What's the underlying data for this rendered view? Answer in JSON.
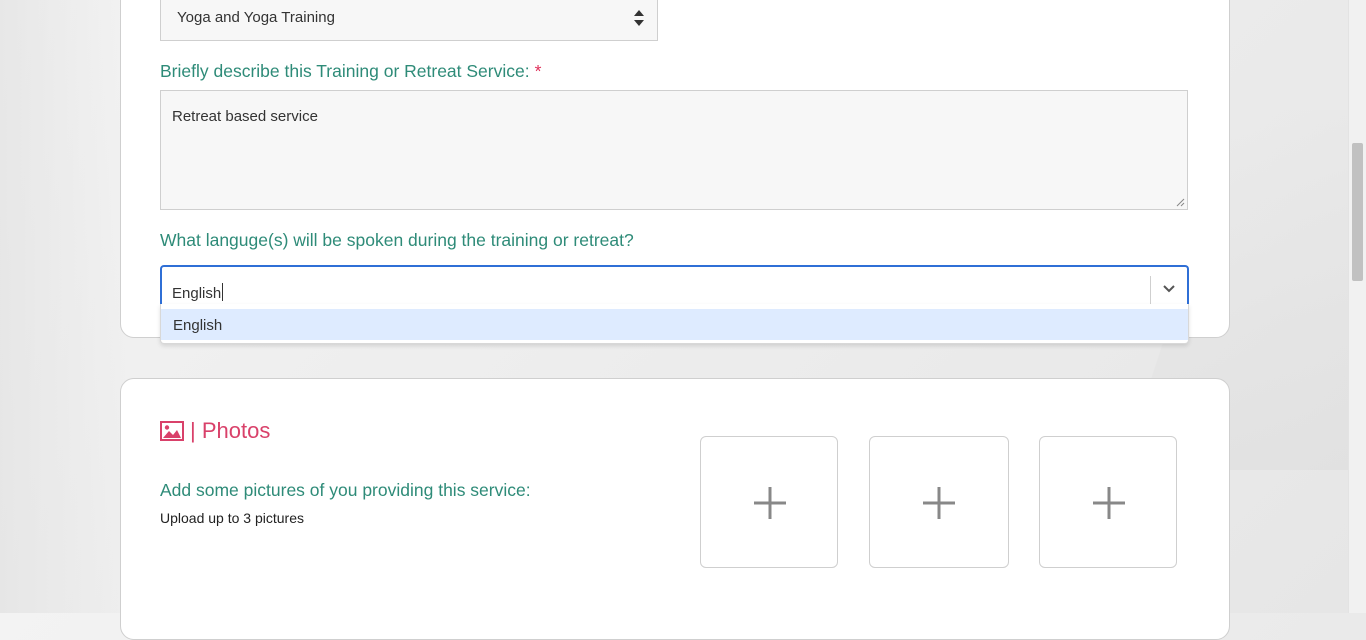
{
  "category_select": {
    "value": "Yoga and Yoga Training"
  },
  "description": {
    "label": "Briefly describe this Training or Retreat Service:",
    "required_mark": "*",
    "value": "Retreat based service"
  },
  "language": {
    "label": "What languge(s) will be spoken during the training or retreat?",
    "input_value": "English",
    "options": [
      "English"
    ]
  },
  "photos": {
    "title": "| Photos",
    "prompt": "Add some pictures of you providing this service:",
    "hint": "Upload up to 3 pictures",
    "slot_icon": "plus-icon",
    "header_icon": "image-icon"
  },
  "colors": {
    "label_green": "#2e8b78",
    "accent_pink": "#d9416a",
    "focus_blue": "#2f6fd6",
    "option_highlight": "#deebff"
  }
}
